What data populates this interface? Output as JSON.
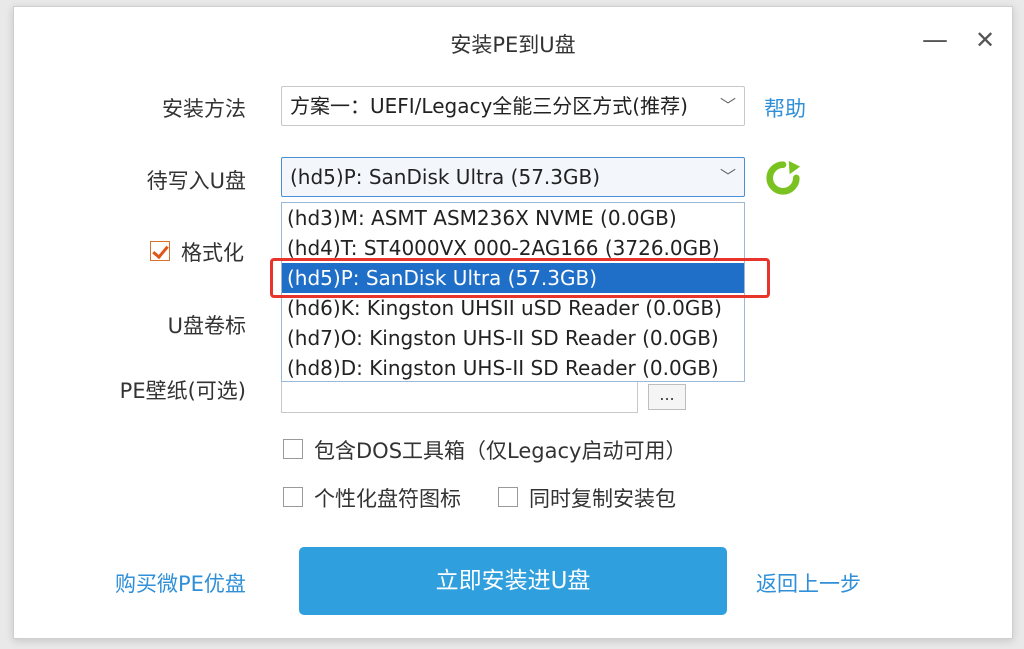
{
  "window": {
    "title": "安装PE到U盘",
    "minimize_label": "—",
    "close_label": "✕"
  },
  "install_method": {
    "label": "安装方法",
    "value": "方案一：UEFI/Legacy全能三分区方式(推荐)",
    "help_link": "帮助"
  },
  "target_disk": {
    "label": "待写入U盘",
    "value": "(hd5)P: SanDisk Ultra (57.3GB)",
    "options": [
      "(hd3)M: ASMT ASM236X NVME (0.0GB)",
      "(hd4)T: ST4000VX 000-2AG166 (3726.0GB)",
      "(hd5)P: SanDisk Ultra (57.3GB)",
      "(hd6)K: Kingston UHSII uSD Reader (0.0GB)",
      "(hd7)O: Kingston UHS-II SD Reader (0.0GB)",
      "(hd8)D: Kingston UHS-II SD Reader (0.0GB)"
    ],
    "selected_index": 2
  },
  "format": {
    "label": "格式化",
    "checked": true
  },
  "volume_label": {
    "label": "U盘卷标"
  },
  "wallpaper": {
    "label": "PE壁纸(可选)",
    "browse_label": "..."
  },
  "options": {
    "dos_tools": "包含DOS工具箱（仅Legacy启动可用）",
    "custom_icon": "个性化盘符图标",
    "copy_package": "同时复制安装包"
  },
  "footer": {
    "buy_link": "购买微PE优盘",
    "install_button": "立即安装进U盘",
    "back_link": "返回上一步"
  },
  "colors": {
    "accent": "#2f9fde",
    "link": "#2f8fd8",
    "selection": "#1f6fc9",
    "highlight": "#e8352b",
    "refresh": "#7ac21f"
  },
  "icons": {
    "refresh": "refresh-icon",
    "dropdown": "chevron-down-icon"
  }
}
